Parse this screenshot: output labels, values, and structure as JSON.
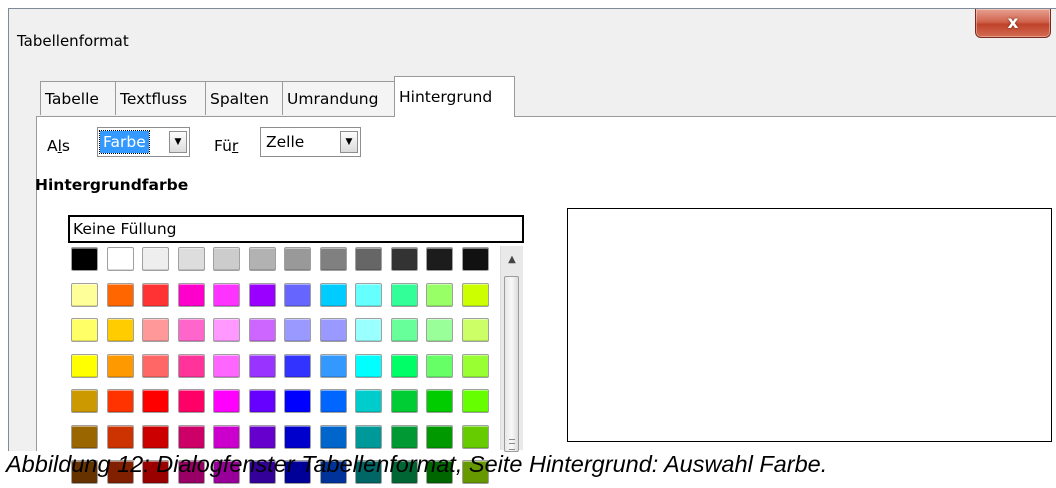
{
  "window": {
    "title": "Tabellenformat",
    "close_label": "x"
  },
  "tabs": [
    {
      "label": "Tabelle"
    },
    {
      "label": "Textfluss"
    },
    {
      "label": "Spalten"
    },
    {
      "label": "Umrandung"
    },
    {
      "label": "Hintergrund",
      "active": true
    }
  ],
  "as_field": {
    "label_pre": "A",
    "label_key": "l",
    "label_post": "s",
    "value": "Farbe"
  },
  "for_field": {
    "label_pre": "Fü",
    "label_key": "r",
    "value": "Zelle"
  },
  "heading": "Hintergrundfarbe",
  "no_fill": "Keine Füllung",
  "palette": {
    "rows": [
      [
        "#000000",
        "#ffffff",
        "#eeeeee",
        "#dddddd",
        "#cccccc",
        "#b2b2b2",
        "#999999",
        "#808080",
        "#666666",
        "#333333",
        "#1c1c1c",
        "#111111"
      ],
      [
        "#ffff99",
        "#ff6600",
        "#ff3333",
        "#ff00cc",
        "#ff33ff",
        "#9900ff",
        "#6666ff",
        "#00ccff",
        "#66ffff",
        "#33ff99",
        "#99ff66",
        "#ccff00"
      ],
      [
        "#ffff66",
        "#ffcc00",
        "#ff9999",
        "#ff66cc",
        "#ff99ff",
        "#cc66ff",
        "#9999ff",
        "#9999ff",
        "#99ffff",
        "#66ff99",
        "#99ff99",
        "#ccff66"
      ],
      [
        "#ffff00",
        "#ff9900",
        "#ff6666",
        "#ff3399",
        "#ff66ff",
        "#9933ff",
        "#3333ff",
        "#3399ff",
        "#00ffff",
        "#00ff66",
        "#66ff66",
        "#99ff33"
      ],
      [
        "#cc9900",
        "#ff3300",
        "#ff0000",
        "#ff0066",
        "#ff00ff",
        "#6600ff",
        "#0000ff",
        "#0066ff",
        "#00cccc",
        "#00cc33",
        "#00cc00",
        "#66ff00"
      ],
      [
        "#996600",
        "#cc3300",
        "#cc0000",
        "#cc0066",
        "#cc00cc",
        "#6600cc",
        "#0000cc",
        "#0066cc",
        "#009999",
        "#009933",
        "#009900",
        "#66cc00"
      ],
      [
        "#663300",
        "#802000",
        "#990000",
        "#990066",
        "#990099",
        "#330099",
        "#000099",
        "#003399",
        "#006666",
        "#006633",
        "#006600",
        "#669900"
      ]
    ]
  },
  "caption": "Abbildung 12: Dialogfenster Tabellenformat, Seite Hintergrund: Auswahl Farbe."
}
